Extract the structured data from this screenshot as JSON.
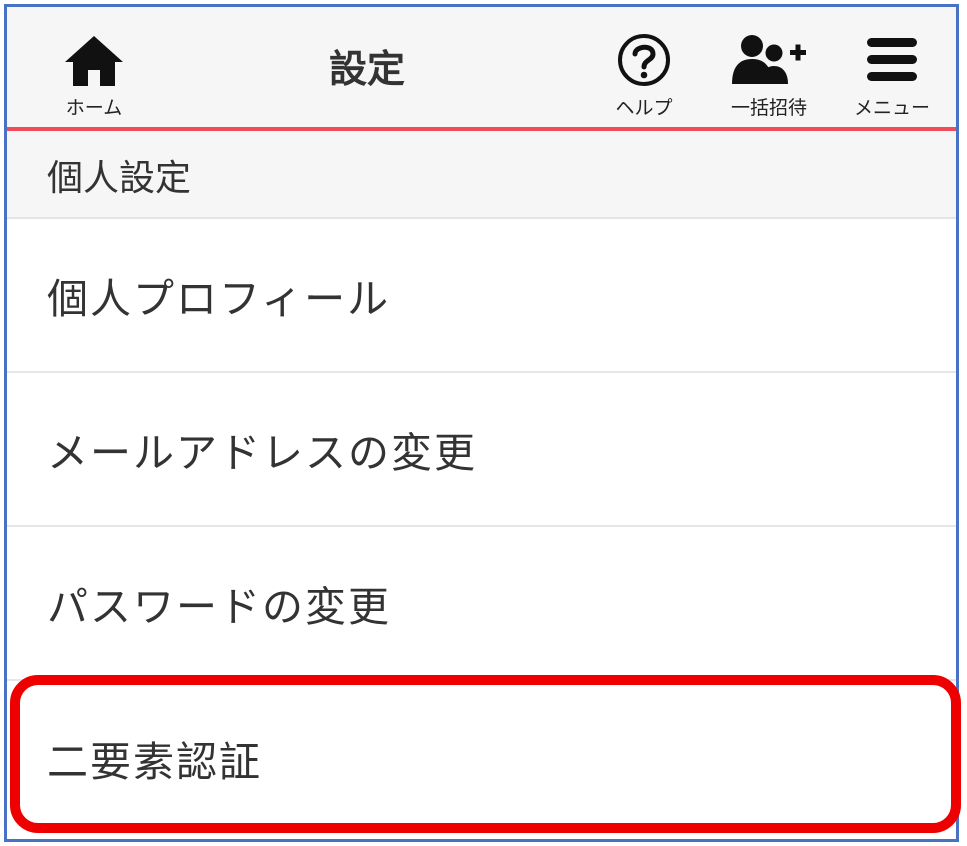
{
  "header": {
    "title": "設定",
    "home_label": "ホーム",
    "help_label": "ヘルプ",
    "invite_label": "一括招待",
    "menu_label": "メニュー"
  },
  "section": {
    "title": "個人設定"
  },
  "items": [
    {
      "label": "個人プロフィール"
    },
    {
      "label": "メールアドレスの変更"
    },
    {
      "label": "パスワードの変更"
    },
    {
      "label": "二要素認証"
    }
  ],
  "colors": {
    "header_bg": "#f6f6f6",
    "accent_line": "#f04b58",
    "highlight_border": "#ee0000",
    "frame_border": "#4a72c4"
  }
}
